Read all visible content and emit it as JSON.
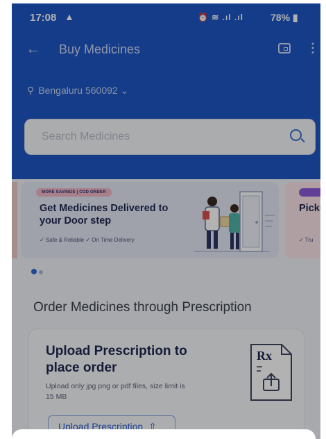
{
  "status_bar": {
    "time": "17:08",
    "alert_icon": "warning-icon",
    "signal_text": "⏰ ≋ .ıl .ıl",
    "battery": "78%"
  },
  "app_bar": {
    "title": "Buy Medicines",
    "location": "Bengaluru 560092",
    "color": "#1d56c4"
  },
  "search": {
    "placeholder": "Search Medicines"
  },
  "carousel": {
    "banners": [
      {
        "badge": "MORE SAVINGS | COD ORDER",
        "title": "Get Medicines Delivered to your Door step",
        "subtitle": "✓ Safe & Reliable   ✓ On Time Delivery"
      },
      {
        "badge": "",
        "title": "Picku store",
        "subtitle": "✓ Tru"
      }
    ],
    "active_index": 0,
    "total": 2
  },
  "section": {
    "title": "Order Medicines through Prescription"
  },
  "prescription_card": {
    "title": "Upload Prescription to place order",
    "subtitle": "Upload only jpg png or pdf files, size limit is 15 MB",
    "button_label": "Upload Prescription",
    "button_icon": "upload-icon",
    "rx_label": "Rx"
  }
}
